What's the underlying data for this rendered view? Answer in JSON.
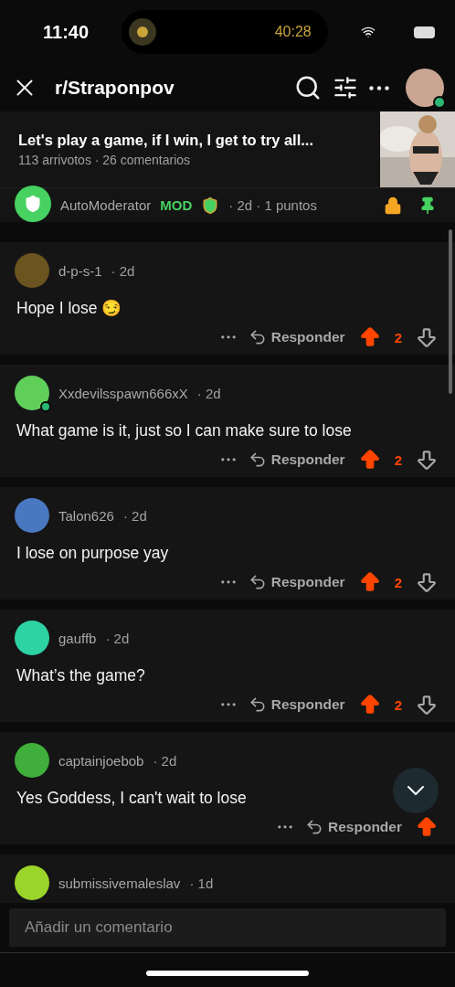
{
  "status_bar": {
    "time": "11:40",
    "timer": "40:28"
  },
  "header": {
    "subreddit": "r/Straponpov",
    "online": true
  },
  "post": {
    "title": "Let's play a game, if I win, I get to try all...",
    "meta": "113 arrivotos · 26 comentarios"
  },
  "pinned": {
    "author": "AutoModerator",
    "badge": "MOD",
    "meta": "· 2d · 1 puntos",
    "locked": true,
    "pinned": true
  },
  "comments": [
    {
      "author": "d-p-s-1",
      "age": "· 2d",
      "text": "Hope I lose 😏",
      "color": "#6b5420",
      "online": false,
      "reply": "Responder",
      "votes": "2",
      "upvoted": true
    },
    {
      "author": "Xxdevilsspawn666xX",
      "age": "· 2d",
      "text": "What game is it, just so I can make sure to lose",
      "color": "#5fcf5a",
      "online": true,
      "reply": "Responder",
      "votes": "2",
      "upvoted": true
    },
    {
      "author": "Talon626",
      "age": "· 2d",
      "text": "I lose on purpose yay",
      "color": "#4a78c0",
      "online": false,
      "reply": "Responder",
      "votes": "2",
      "upvoted": true
    },
    {
      "author": "gauffb",
      "age": "· 2d",
      "text": "What’s the game?",
      "color": "#2ed3a4",
      "online": false,
      "reply": "Responder",
      "votes": "2",
      "upvoted": true
    },
    {
      "author": "captainjoebob",
      "age": "· 2d",
      "text": "Yes Goddess, I can't wait to lose",
      "color": "#3fae3a",
      "online": false,
      "reply": "Responder",
      "upvoted": true
    },
    {
      "author": "submissivemaleslav",
      "age": "· 1d",
      "color": "#9bd42a",
      "online": false
    }
  ],
  "composer": {
    "placeholder": "Añadir un comentario"
  }
}
